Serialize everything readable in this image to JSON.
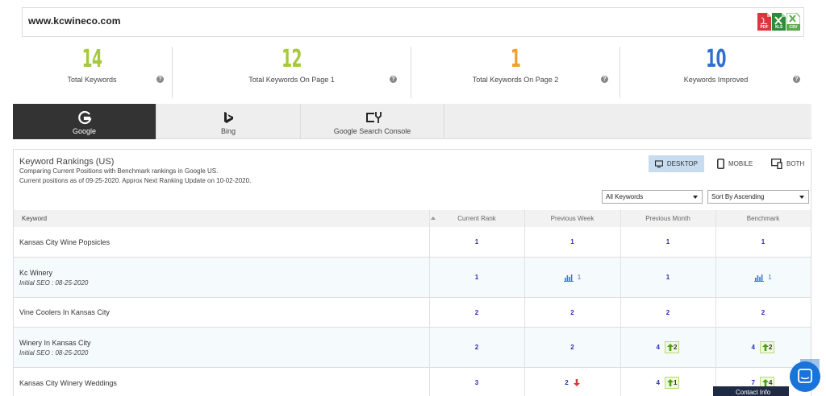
{
  "url": "www.kcwineco.com",
  "exports": [
    {
      "icon": "pdf-export-icon",
      "label": "PDF",
      "color": "#d9363e"
    },
    {
      "icon": "xls-export-icon",
      "label": "XLS",
      "color": "#2e8b3a"
    },
    {
      "icon": "csv-export-icon",
      "label": "CSV",
      "color": "#5aa84a"
    }
  ],
  "stats": [
    {
      "value": "14",
      "label": "Total Keywords",
      "color": "#a6c83c"
    },
    {
      "value": "12",
      "label": "Total Keywords On Page 1",
      "color": "#a6c83c"
    },
    {
      "value": "1",
      "label": "Total Keywords On Page 2",
      "color": "#f0a030"
    },
    {
      "value": "10",
      "label": "Keywords Improved",
      "color": "#2f6fd1"
    }
  ],
  "help_glyph": "?",
  "tabs": [
    {
      "label": "Google",
      "icon": "google-icon",
      "active": true
    },
    {
      "label": "Bing",
      "icon": "bing-icon",
      "active": false
    },
    {
      "label": "Google Search Console",
      "icon": "search-console-icon",
      "active": false
    }
  ],
  "panel": {
    "title": "Keyword Rankings (US)",
    "subtitle1": "Comparing Current Positions with Benchmark rankings in Google US.",
    "subtitle2": "Current positions as of 09-25-2020. Approx Next Ranking Update on 10-02-2020."
  },
  "devices": {
    "desktop": "DESKTOP",
    "mobile": "MOBILE",
    "both": "BOTH",
    "selected": "desktop"
  },
  "filters": {
    "keyword_filter": "All Keywords",
    "sort": "Sort By Ascending"
  },
  "table": {
    "headers": {
      "keyword": "Keyword",
      "current": "Current Rank",
      "prev_week": "Previous Week",
      "prev_month": "Previous Month",
      "benchmark": "Benchmark"
    },
    "rows": [
      {
        "keyword": "Kansas City Wine Popsicles",
        "note": "",
        "current": "1",
        "prev_week": "1",
        "prev_week_chart": false,
        "prev_week_trend": "",
        "prev_month": "1",
        "prev_month_delta": "",
        "benchmark": "1",
        "benchmark_chart": false,
        "benchmark_delta": ""
      },
      {
        "keyword": "Kc Winery",
        "note": "Initial SEO : 08-25-2020",
        "current": "1",
        "prev_week": "1",
        "prev_week_chart": true,
        "prev_week_trend": "",
        "prev_month": "1",
        "prev_month_delta": "",
        "benchmark": "1",
        "benchmark_chart": true,
        "benchmark_delta": ""
      },
      {
        "keyword": "Vine Coolers In Kansas City",
        "note": "",
        "current": "2",
        "prev_week": "2",
        "prev_week_chart": false,
        "prev_week_trend": "",
        "prev_month": "2",
        "prev_month_delta": "",
        "benchmark": "2",
        "benchmark_chart": false,
        "benchmark_delta": ""
      },
      {
        "keyword": "Winery In Kansas City",
        "note": "Initial SEO : 08-25-2020",
        "current": "2",
        "prev_week": "2",
        "prev_week_chart": false,
        "prev_week_trend": "",
        "prev_month": "4",
        "prev_month_delta": "2",
        "benchmark": "4",
        "benchmark_chart": false,
        "benchmark_delta": "2"
      },
      {
        "keyword": "Kansas City Winery Weddings",
        "note": "",
        "current": "3",
        "prev_week": "2",
        "prev_week_chart": false,
        "prev_week_trend": "down",
        "prev_month": "4",
        "prev_month_delta": "1",
        "benchmark": "7",
        "benchmark_chart": false,
        "benchmark_delta": "4"
      }
    ]
  },
  "contact": "Contact Info",
  "colors": {
    "rank_blue": "#2b2bb5",
    "up_green": "#4a9e1c",
    "down_red": "#d9363e",
    "tab_active": "#333333"
  }
}
